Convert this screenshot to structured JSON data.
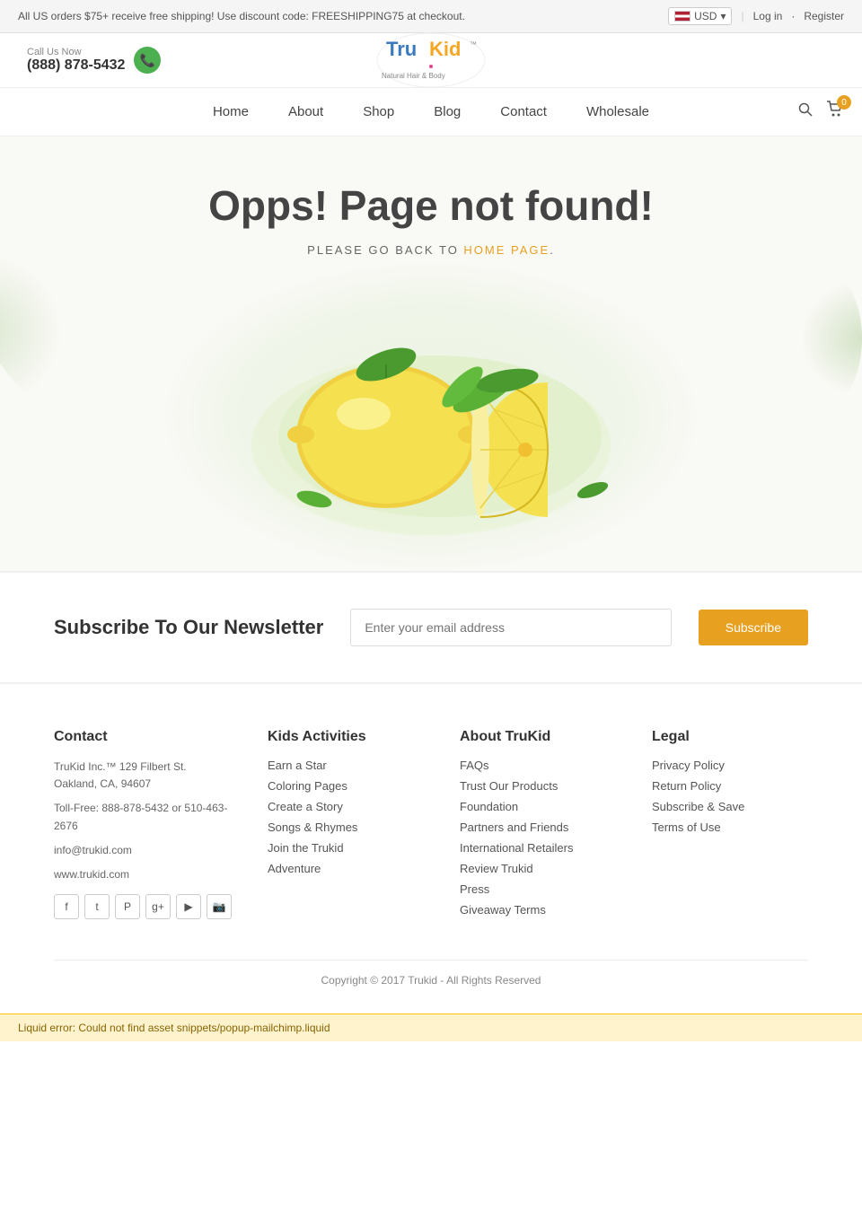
{
  "topbar": {
    "promo": "All US orders $75+ receive free shipping! Use discount code: FREESHIPPING75 at checkout.",
    "currency": "USD",
    "login": "Log in",
    "register": "Register"
  },
  "header": {
    "call_label": "Call Us Now",
    "phone": "(888) 878-5432",
    "cart_count": "0"
  },
  "nav": {
    "links": [
      {
        "label": "Home",
        "id": "home"
      },
      {
        "label": "About",
        "id": "about"
      },
      {
        "label": "Shop",
        "id": "shop"
      },
      {
        "label": "Blog",
        "id": "blog"
      },
      {
        "label": "Contact",
        "id": "contact"
      },
      {
        "label": "Wholesale",
        "id": "wholesale"
      }
    ]
  },
  "error_page": {
    "title": "Opps! Page not found!",
    "subtitle": "PLEASE GO BACK TO HOME PAGE."
  },
  "newsletter": {
    "title": "Subscribe To Our Newsletter",
    "placeholder": "Enter your email address",
    "button": "Subscribe"
  },
  "footer": {
    "contact": {
      "title": "Contact",
      "address": "TruKid Inc.™ 129 Filbert St. Oakland, CA, 94607",
      "tollfree": "Toll-Free: 888-878-5432 or 510-463-2676",
      "email": "info@trukid.com",
      "website": "www.trukid.com"
    },
    "kids_activities": {
      "title": "Kids Activities",
      "links": [
        "Earn a Star",
        "Coloring Pages",
        "Create a Story",
        "Songs & Rhymes",
        "Join the Trukid",
        "Adventure"
      ]
    },
    "about_trukid": {
      "title": "About TruKid",
      "links": [
        "FAQs",
        "Trust Our Products",
        "Foundation",
        "Partners and Friends",
        "International Retailers",
        "Review Trukid",
        "Press",
        "Giveaway Terms"
      ]
    },
    "legal": {
      "title": "Legal",
      "links": [
        "Privacy Policy",
        "Return Policy",
        "Subscribe & Save",
        "Terms of Use"
      ]
    },
    "copyright": "Copyright © 2017 Trukid - All Rights Reserved"
  },
  "liquid_error": "Liquid error: Could not find asset snippets/popup-mailchimp.liquid"
}
